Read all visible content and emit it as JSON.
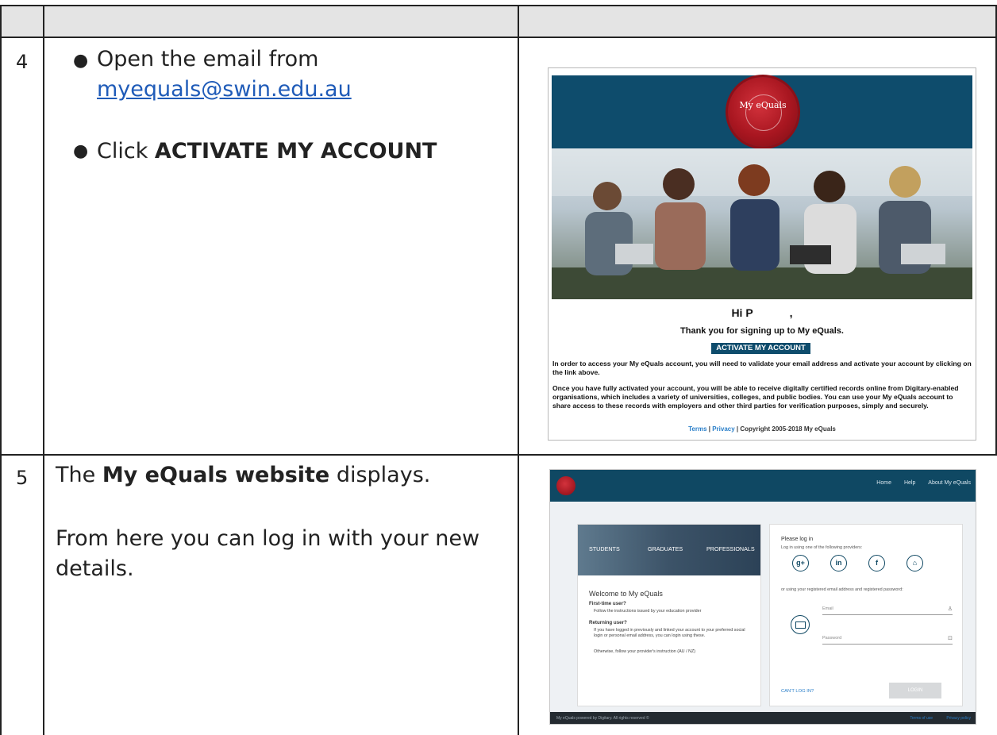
{
  "rows": [
    {
      "number": "4",
      "bullets": [
        {
          "text": "Open the email from",
          "link": "myequals@swin.edu.au"
        },
        {
          "prefix": "Click ",
          "bold": "ACTIVATE MY ACCOUNT"
        }
      ]
    },
    {
      "number": "5",
      "line1_prefix": "The ",
      "line1_bold": "My eQuals website",
      "line1_suffix": " displays.",
      "line2": "From here you can log in with your new details."
    }
  ],
  "email": {
    "seal_text": "My eQuals",
    "greeting": "Hi P",
    "greeting_suffix": ",",
    "thanks": "Thank you for signing up to My eQuals.",
    "button": "ACTIVATE MY ACCOUNT",
    "para1": "In order to access your My eQuals account, you will need to validate your email address and activate your account by clicking on the link above.",
    "para2": "Once you have fully activated your account, you will be able to receive digitally certified records online from Digitary-enabled organisations, which includes a variety of universities, colleges, and public bodies. You can use your My eQuals account to share access to these records with employers and other third parties for verification purposes, simply and securely.",
    "footer_terms": "Terms",
    "footer_sep": " | ",
    "footer_privacy": "Privacy",
    "footer_copy": " | Copyright 2005-2018 My eQuals"
  },
  "site": {
    "nav": [
      "Home",
      "Help",
      "About My eQuals"
    ],
    "hero_labels": [
      "STUDENTS",
      "GRADUATES",
      "PROFESSIONALS"
    ],
    "welcome": "Welcome to My eQuals",
    "first_time_title": "First-time user?",
    "first_time_text": "Follow the instructions issued by your education provider",
    "returning_title": "Returning user?",
    "returning_text": "If you have logged in previously and linked your account to your preferred social login or personal email address, you can login using these.",
    "otherwise_text": "Otherwise, follow your provider's instruction (AU / NZ)",
    "please_login": "Please log in",
    "login_using": "Log in using one of the following providers:",
    "or_using": "or using your registered email address and registered password:",
    "email_placeholder": "Email",
    "password_placeholder": "Password",
    "cant_login": "CAN'T LOG IN?",
    "login_button": "LOGIN",
    "social": [
      "g+",
      "in",
      "f",
      "⌂"
    ],
    "footer_left": "My eQuals powered by Digitary. All rights reserved ©",
    "footer_links": [
      "Terms of use",
      "Privacy policy"
    ]
  }
}
